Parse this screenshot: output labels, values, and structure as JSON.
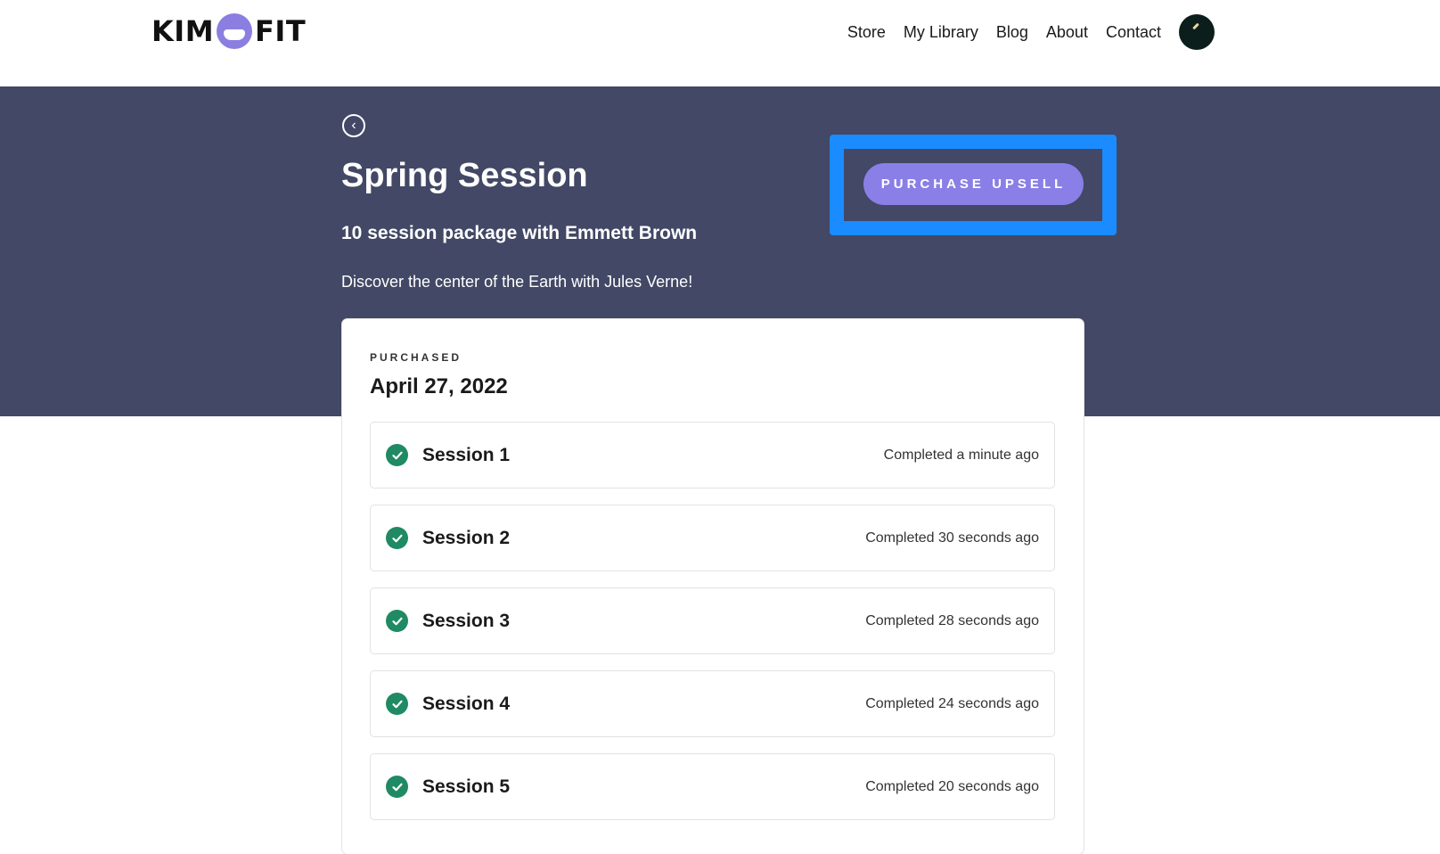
{
  "header": {
    "logo_left": "KIM",
    "logo_right": "FIT",
    "nav": [
      "Store",
      "My Library",
      "Blog",
      "About",
      "Contact"
    ]
  },
  "hero": {
    "title": "Spring Session",
    "subtitle": "10 session package with Emmett Brown",
    "description": "Discover the center of the Earth with Jules Verne!",
    "purchase_button": "PURCHASE UPSELL"
  },
  "card": {
    "eyebrow": "PURCHASED",
    "date": "April 27, 2022",
    "sessions": [
      {
        "name": "Session 1",
        "status": "Completed a minute ago"
      },
      {
        "name": "Session 2",
        "status": "Completed 30 seconds ago"
      },
      {
        "name": "Session 3",
        "status": "Completed 28 seconds ago"
      },
      {
        "name": "Session 4",
        "status": "Completed 24 seconds ago"
      },
      {
        "name": "Session 5",
        "status": "Completed 20 seconds ago"
      }
    ]
  },
  "colors": {
    "hero_bg": "#424865",
    "accent": "#8a7fe6",
    "highlight": "#1a8cff",
    "check": "#1f8a63"
  },
  "icons": {
    "back": "chevron-left-icon",
    "session": "check-circle-icon",
    "logo_mark": "logo-mark-icon"
  }
}
